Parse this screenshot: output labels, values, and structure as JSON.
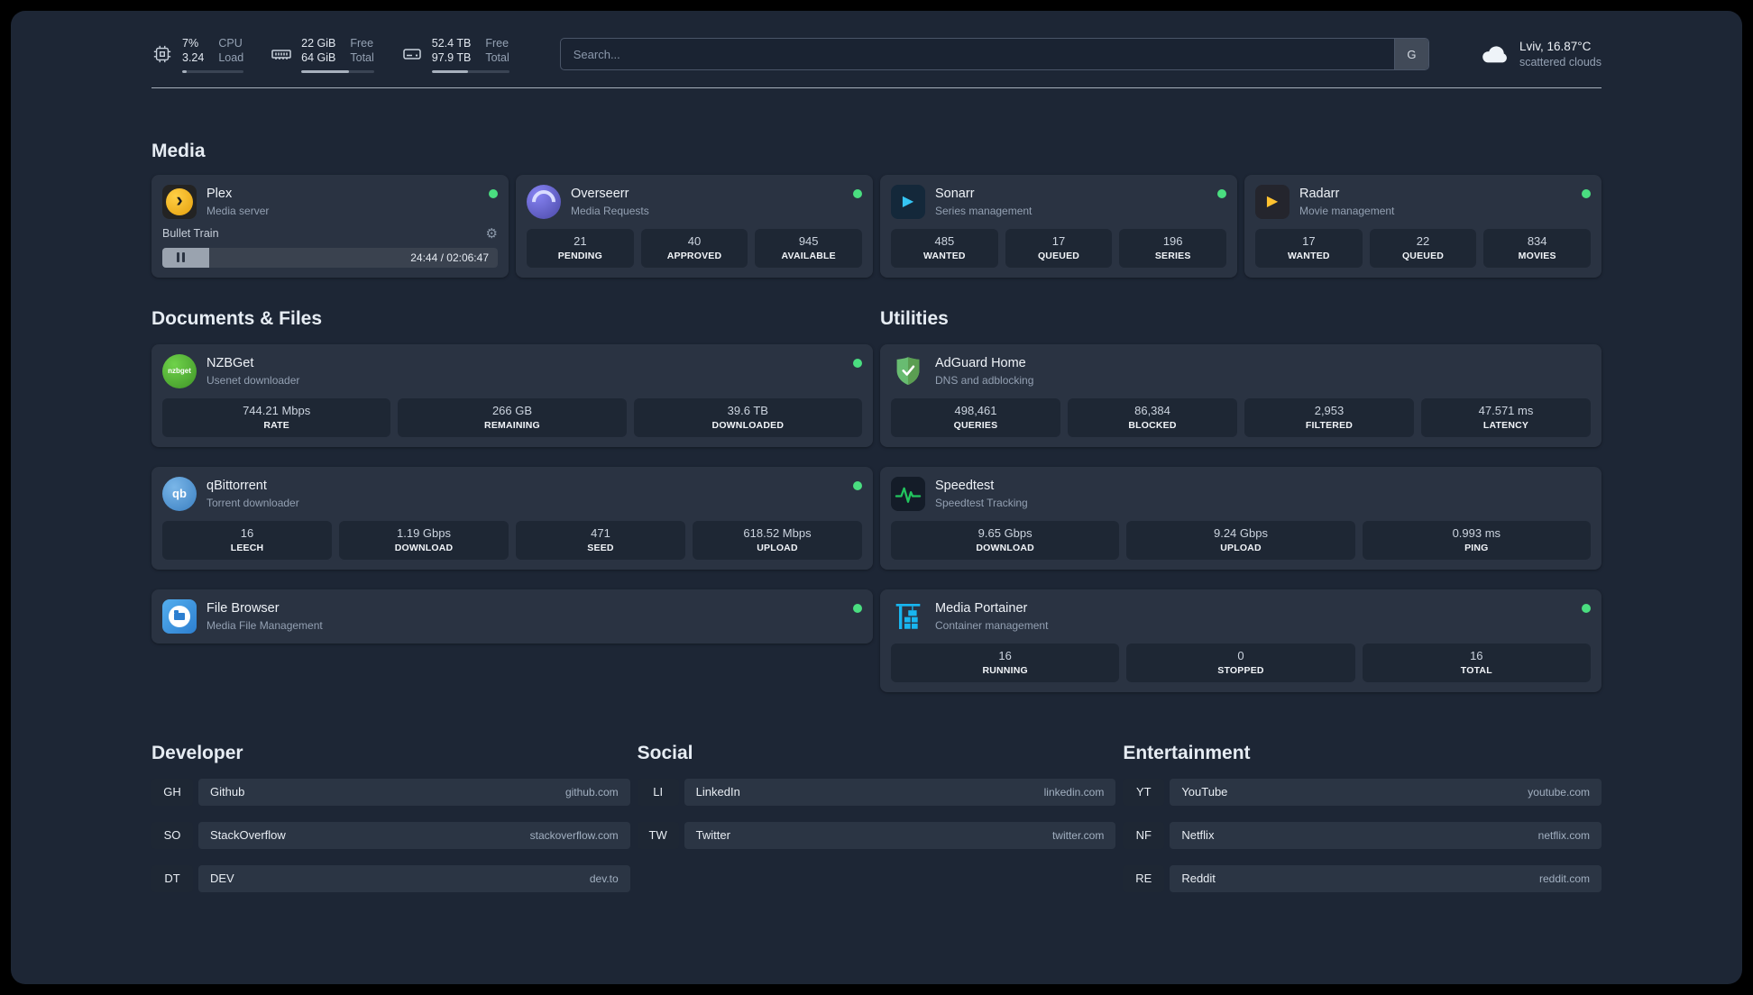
{
  "topbar": {
    "cpu": {
      "v1": "7%",
      "v2": "3.24",
      "l1": "CPU",
      "l2": "Load",
      "progress": 7
    },
    "memory": {
      "v1": "22 GiB",
      "v2": "64 GiB",
      "l1": "Free",
      "l2": "Total",
      "progress": 66
    },
    "disk": {
      "v1": "52.4 TB",
      "v2": "97.9 TB",
      "l1": "Free",
      "l2": "Total",
      "progress": 47
    },
    "search": {
      "placeholder": "Search...",
      "button_label": "G"
    },
    "weather": {
      "location": "Lviv, 16.87°C",
      "condition": "scattered clouds"
    }
  },
  "media": {
    "heading": "Media",
    "plex": {
      "title": "Plex",
      "subtitle": "Media server",
      "now_playing": "Bullet Train",
      "time": "24:44 / 02:06:47",
      "progress_percent": 14,
      "status": "online"
    },
    "overseerr": {
      "title": "Overseerr",
      "subtitle": "Media Requests",
      "status": "online",
      "stats": [
        {
          "value": "21",
          "label": "PENDING"
        },
        {
          "value": "40",
          "label": "APPROVED"
        },
        {
          "value": "945",
          "label": "AVAILABLE"
        }
      ]
    },
    "sonarr": {
      "title": "Sonarr",
      "subtitle": "Series management",
      "status": "online",
      "stats": [
        {
          "value": "485",
          "label": "WANTED"
        },
        {
          "value": "17",
          "label": "QUEUED"
        },
        {
          "value": "196",
          "label": "SERIES"
        }
      ]
    },
    "radarr": {
      "title": "Radarr",
      "subtitle": "Movie management",
      "status": "online",
      "stats": [
        {
          "value": "17",
          "label": "WANTED"
        },
        {
          "value": "22",
          "label": "QUEUED"
        },
        {
          "value": "834",
          "label": "MOVIES"
        }
      ]
    }
  },
  "documents": {
    "heading": "Documents & Files",
    "nzbget": {
      "title": "NZBGet",
      "subtitle": "Usenet downloader",
      "status": "online",
      "stats": [
        {
          "value": "744.21 Mbps",
          "label": "RATE"
        },
        {
          "value": "266 GB",
          "label": "REMAINING"
        },
        {
          "value": "39.6 TB",
          "label": "DOWNLOADED"
        }
      ]
    },
    "qbittorrent": {
      "title": "qBittorrent",
      "subtitle": "Torrent downloader",
      "status": "online",
      "stats": [
        {
          "value": "16",
          "label": "LEECH"
        },
        {
          "value": "1.19 Gbps",
          "label": "DOWNLOAD"
        },
        {
          "value": "471",
          "label": "SEED"
        },
        {
          "value": "618.52 Mbps",
          "label": "UPLOAD"
        }
      ]
    },
    "filebrowser": {
      "title": "File Browser",
      "subtitle": "Media File Management",
      "status": "online"
    }
  },
  "utilities": {
    "heading": "Utilities",
    "adguard": {
      "title": "AdGuard Home",
      "subtitle": "DNS and adblocking",
      "stats": [
        {
          "value": "498,461",
          "label": "QUERIES"
        },
        {
          "value": "86,384",
          "label": "BLOCKED"
        },
        {
          "value": "2,953",
          "label": "FILTERED"
        },
        {
          "value": "47.571 ms",
          "label": "LATENCY"
        }
      ]
    },
    "speedtest": {
      "title": "Speedtest",
      "subtitle": "Speedtest Tracking",
      "stats": [
        {
          "value": "9.65 Gbps",
          "label": "DOWNLOAD"
        },
        {
          "value": "9.24 Gbps",
          "label": "UPLOAD"
        },
        {
          "value": "0.993 ms",
          "label": "PING"
        }
      ]
    },
    "portainer": {
      "title": "Media Portainer",
      "subtitle": "Container management",
      "status": "online",
      "stats": [
        {
          "value": "16",
          "label": "RUNNING"
        },
        {
          "value": "0",
          "label": "STOPPED"
        },
        {
          "value": "16",
          "label": "TOTAL"
        }
      ]
    }
  },
  "bookmarks": {
    "developer": {
      "heading": "Developer",
      "items": [
        {
          "abbr": "GH",
          "name": "Github",
          "url": "github.com"
        },
        {
          "abbr": "SO",
          "name": "StackOverflow",
          "url": "stackoverflow.com"
        },
        {
          "abbr": "DT",
          "name": "DEV",
          "url": "dev.to"
        }
      ]
    },
    "social": {
      "heading": "Social",
      "items": [
        {
          "abbr": "LI",
          "name": "LinkedIn",
          "url": "linkedin.com"
        },
        {
          "abbr": "TW",
          "name": "Twitter",
          "url": "twitter.com"
        }
      ]
    },
    "entertainment": {
      "heading": "Entertainment",
      "items": [
        {
          "abbr": "YT",
          "name": "YouTube",
          "url": "youtube.com"
        },
        {
          "abbr": "NF",
          "name": "Netflix",
          "url": "netflix.com"
        },
        {
          "abbr": "RE",
          "name": "Reddit",
          "url": "reddit.com"
        }
      ]
    }
  },
  "icons": {
    "nzbget_label": "nzbget",
    "qbittorrent_label": "qb"
  },
  "colors": {
    "background": "#1d2635",
    "card": "#2a3342",
    "tile": "#1e2734",
    "status_online": "#4ade80",
    "plex": "#e5a00d",
    "overseerr": "#6366f1",
    "sonarr": "#35c5f4",
    "radarr": "#ffc230",
    "nzbget": "#54ae32",
    "qbittorrent": "#4d96d3",
    "adguard": "#68bc71",
    "speedtest_line": "#22c55e",
    "portainer": "#18b6f0",
    "filebrowser": "#2d7fd0"
  }
}
